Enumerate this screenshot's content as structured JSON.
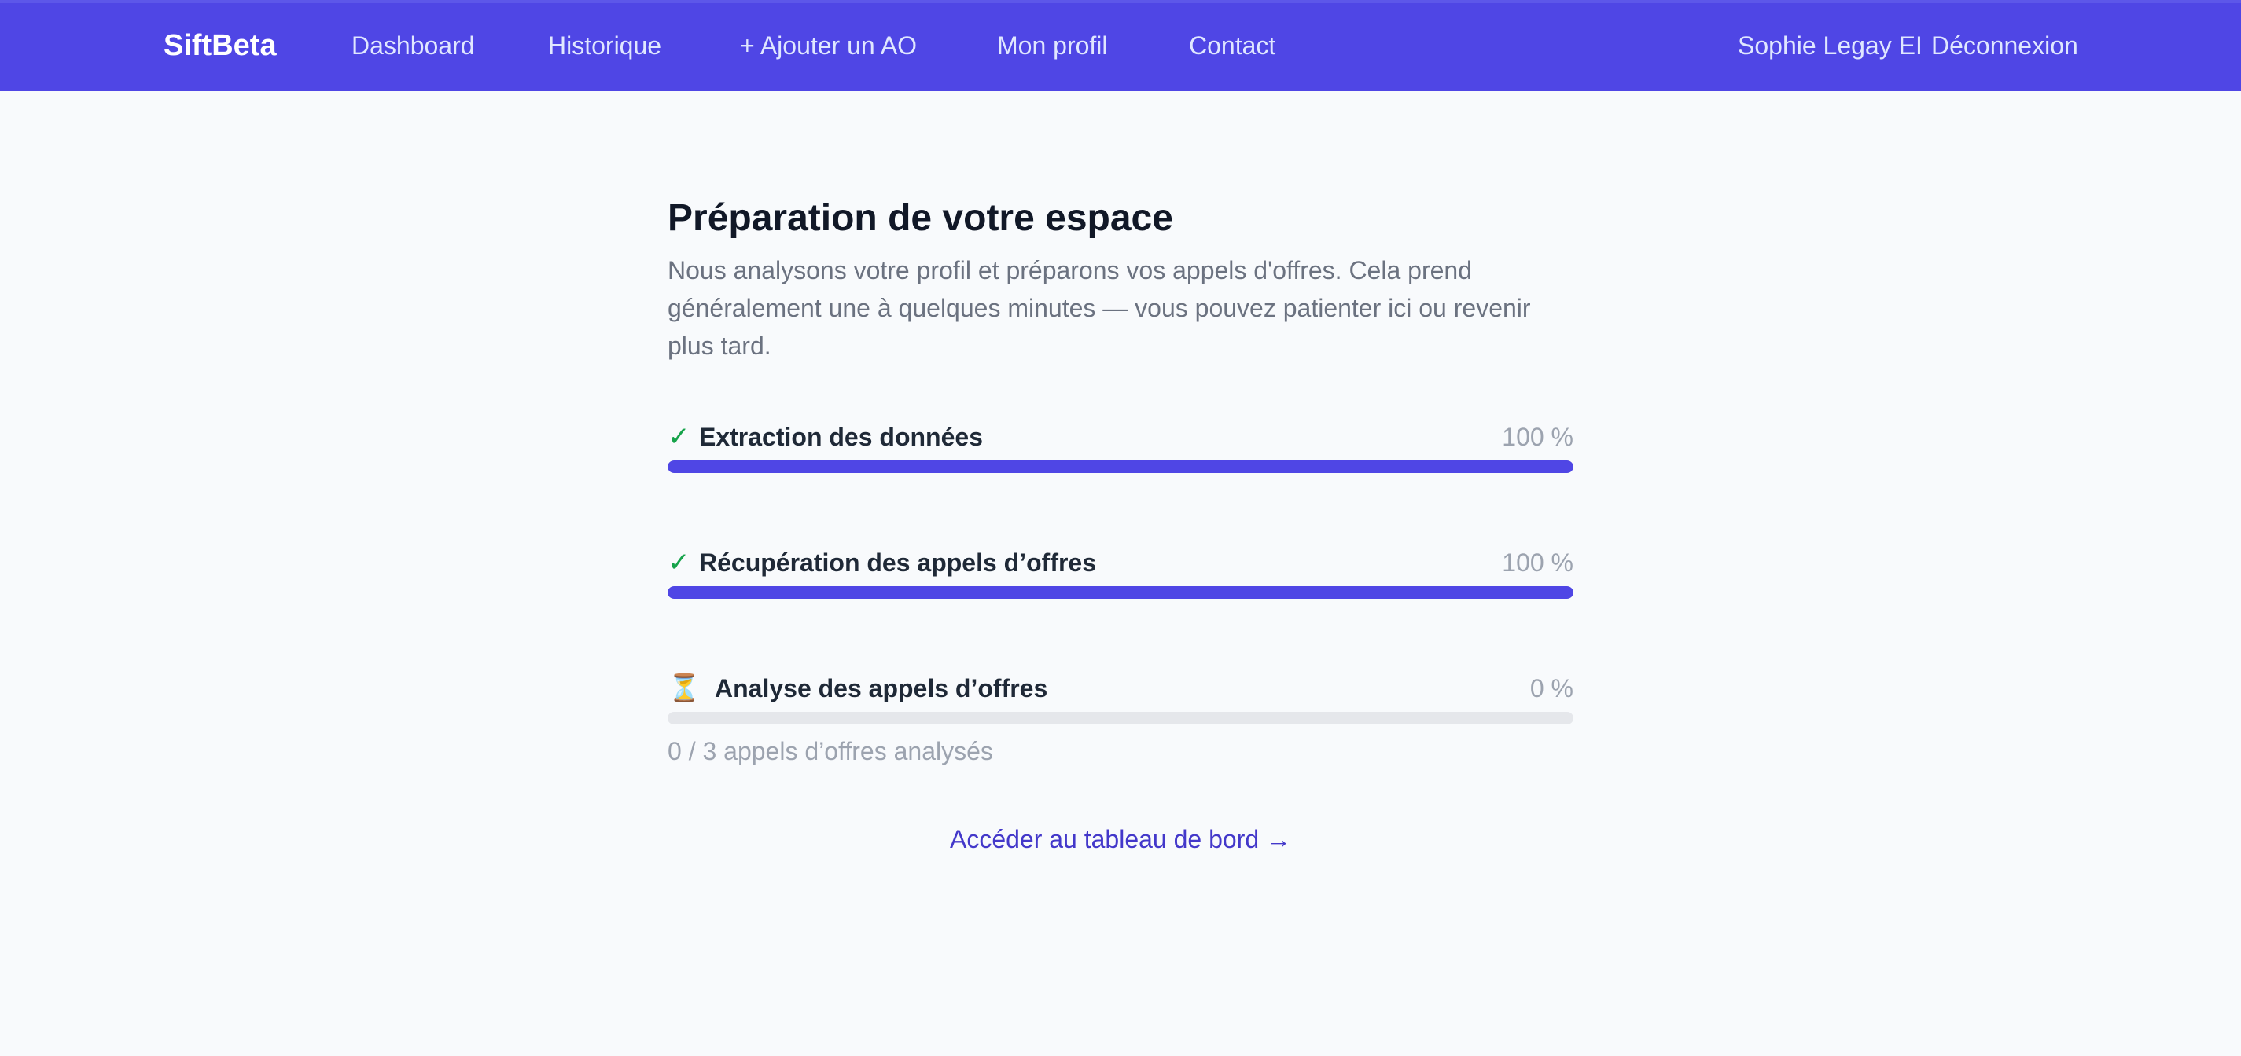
{
  "navbar": {
    "brand": "SiftBeta",
    "links": {
      "dashboard": "Dashboard",
      "history": "Historique",
      "add_tender": "+ Ajouter un AO",
      "profile": "Mon profil",
      "contact": "Contact"
    },
    "user_name": "Sophie Legay EI",
    "logout": "Déconnexion"
  },
  "main": {
    "title": "Préparation de votre espace",
    "subtitle": "Nous analysons votre profil et préparons vos appels d'offres. Cela prend généralement une à quelques minutes — vous pouvez patienter ici ou revenir plus tard.",
    "steps": [
      {
        "icon": "check-icon",
        "icon_glyph": "✓",
        "label": "Extraction des données",
        "percent_text": "100 %",
        "progress": 1.0
      },
      {
        "icon": "check-icon",
        "icon_glyph": "✓",
        "label": "Récupération des appels d’offres",
        "percent_text": "100 %",
        "progress": 1.0
      },
      {
        "icon": "hourglass-icon",
        "icon_glyph": "⏳",
        "label": "Analyse des appels d’offres",
        "percent_text": "0 %",
        "progress": 0.0,
        "note": "0 / 3 appels d’offres analysés"
      }
    ],
    "dashboard_link": "Accéder au tableau de bord →"
  },
  "colors": {
    "accent": "#4f46e5",
    "success": "#16a34a",
    "track": "#e5e7eb"
  }
}
